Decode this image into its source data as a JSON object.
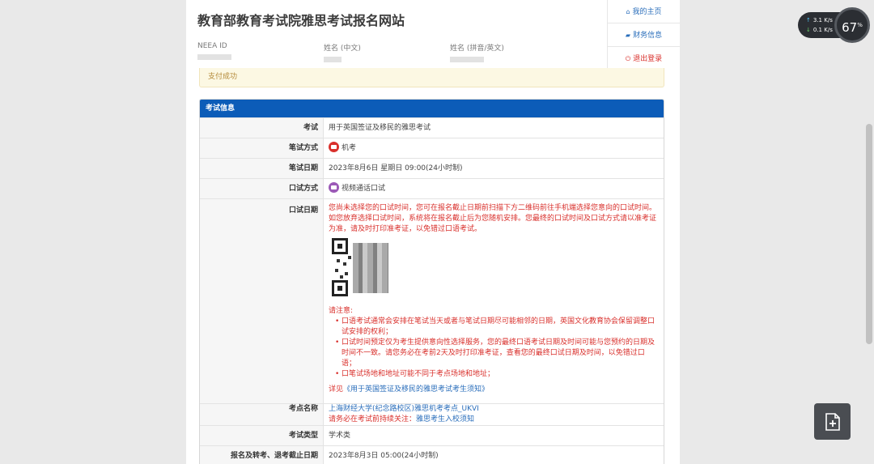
{
  "header": {
    "title": "教育部教育考试院雅思考试报名网站",
    "neea_label": "NEEA ID",
    "name_cn_label": "姓名 (中文)",
    "name_en_label": "姓名 (拼音/英文)"
  },
  "menu": {
    "home": "我的主页",
    "finance": "财务信息",
    "logout": "退出登录"
  },
  "alert": {
    "text": "支付成功"
  },
  "panel": {
    "title": "考试信息",
    "rows": {
      "exam": {
        "label": "考试",
        "value": "用于英国签证及移民的雅思考试"
      },
      "written_mode": {
        "label": "笔试方式",
        "value": "机考"
      },
      "written_date": {
        "label": "笔试日期",
        "value": "2023年8月6日 星期日 09:00(24小时制)"
      },
      "oral_mode": {
        "label": "口试方式",
        "value": "视频通话口试"
      },
      "oral_date": {
        "label": "口试日期",
        "text": "您尚未选择您的口试时间，您可在报名截止日期前扫描下方二维码前往手机端选择您意向的口试时间。如您放弃选择口试时间，系统将在报名截止后为您随机安排。您最终的口试时间及口试方式请以准考证为准，请及时打印准考证，以免错过口语考试。",
        "note_title": "请注意:",
        "notes": [
          "口语考试通常会安排在笔试当天或者与笔试日期尽可能相邻的日期，英国文化教育协会保留调整口试安排的权利；",
          "口试时间预定仅为考生提供意向性选择服务，您的最终口语考试日期及时间可能与您预约的日期及时间不一致。请您务必在考前2天及时打印准考证，查看您的最终口试日期及时间，以免错过口语；",
          "口笔试场地和地址可能不同于考点场地和地址；"
        ],
        "detail_prefix": "详见",
        "detail_link": "《用于英国签证及移民的雅思考试考生须知》"
      },
      "venue": {
        "label": "考点名称",
        "link": "上海财经大学(纪念路校区)雅思机考考点_UKVI",
        "note_prefix": "请务必在考试前持续关注：",
        "note_link": "雅思考生入校须知"
      },
      "exam_type": {
        "label": "考试类型",
        "value": "学术类"
      },
      "deadline": {
        "label": "报名及转考、退考截止日期",
        "value": "2023年8月3日 05:00(24小时制)"
      }
    }
  },
  "widget": {
    "upload_speed": "3.1",
    "download_speed": "0.1",
    "speed_unit": "K/s",
    "percent": "67",
    "percent_unit": "%"
  }
}
